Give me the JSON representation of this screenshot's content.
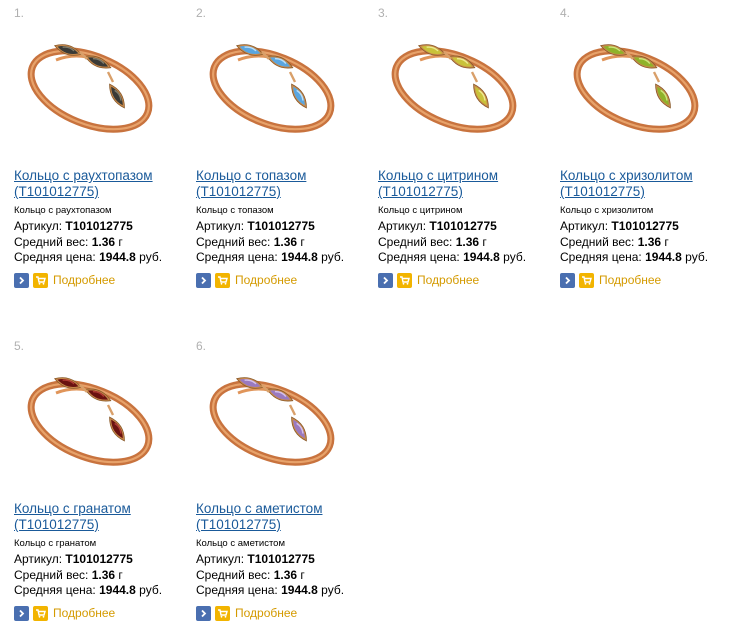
{
  "action_label": "Подробнее",
  "labels": {
    "article": "Артикул:",
    "weight": "Средний вес:",
    "price": "Средняя цена:"
  },
  "units": {
    "weight": "г",
    "price": "руб."
  },
  "products": [
    {
      "num": "1.",
      "title": "Кольцо с раухтопазом (Т101012775)",
      "subtitle": "Кольцо с раухтопазом",
      "article": "Т101012775",
      "weight": "1.36",
      "price": "1944.8",
      "stone_color": "#3a3a36",
      "stone_highlight": "#8a8470"
    },
    {
      "num": "2.",
      "title": "Кольцо с топазом (Т101012775)",
      "subtitle": "Кольцо с топазом",
      "article": "Т101012775",
      "weight": "1.36",
      "price": "1944.8",
      "stone_color": "#5aa6e0",
      "stone_highlight": "#c8e6fa"
    },
    {
      "num": "3.",
      "title": "Кольцо с цитрином (Т101012775)",
      "subtitle": "Кольцо с цитрином",
      "article": "Т101012775",
      "weight": "1.36",
      "price": "1944.8",
      "stone_color": "#c9c23a",
      "stone_highlight": "#f1ee9a"
    },
    {
      "num": "4.",
      "title": "Кольцо с хризолитом (Т101012775)",
      "subtitle": "Кольцо с хризолитом",
      "article": "Т101012775",
      "weight": "1.36",
      "price": "1944.8",
      "stone_color": "#8fb22a",
      "stone_highlight": "#d6ea86"
    },
    {
      "num": "5.",
      "title": "Кольцо с гранатом (Т101012775)",
      "subtitle": "Кольцо с гранатом",
      "article": "Т101012775",
      "weight": "1.36",
      "price": "1944.8",
      "stone_color": "#6a1210",
      "stone_highlight": "#b8403a"
    },
    {
      "num": "6.",
      "title": "Кольцо с аметистом (Т101012775)",
      "subtitle": "Кольцо с аметистом",
      "article": "Т101012775",
      "weight": "1.36",
      "price": "1944.8",
      "stone_color": "#9a7ac0",
      "stone_highlight": "#dccaf0"
    }
  ]
}
